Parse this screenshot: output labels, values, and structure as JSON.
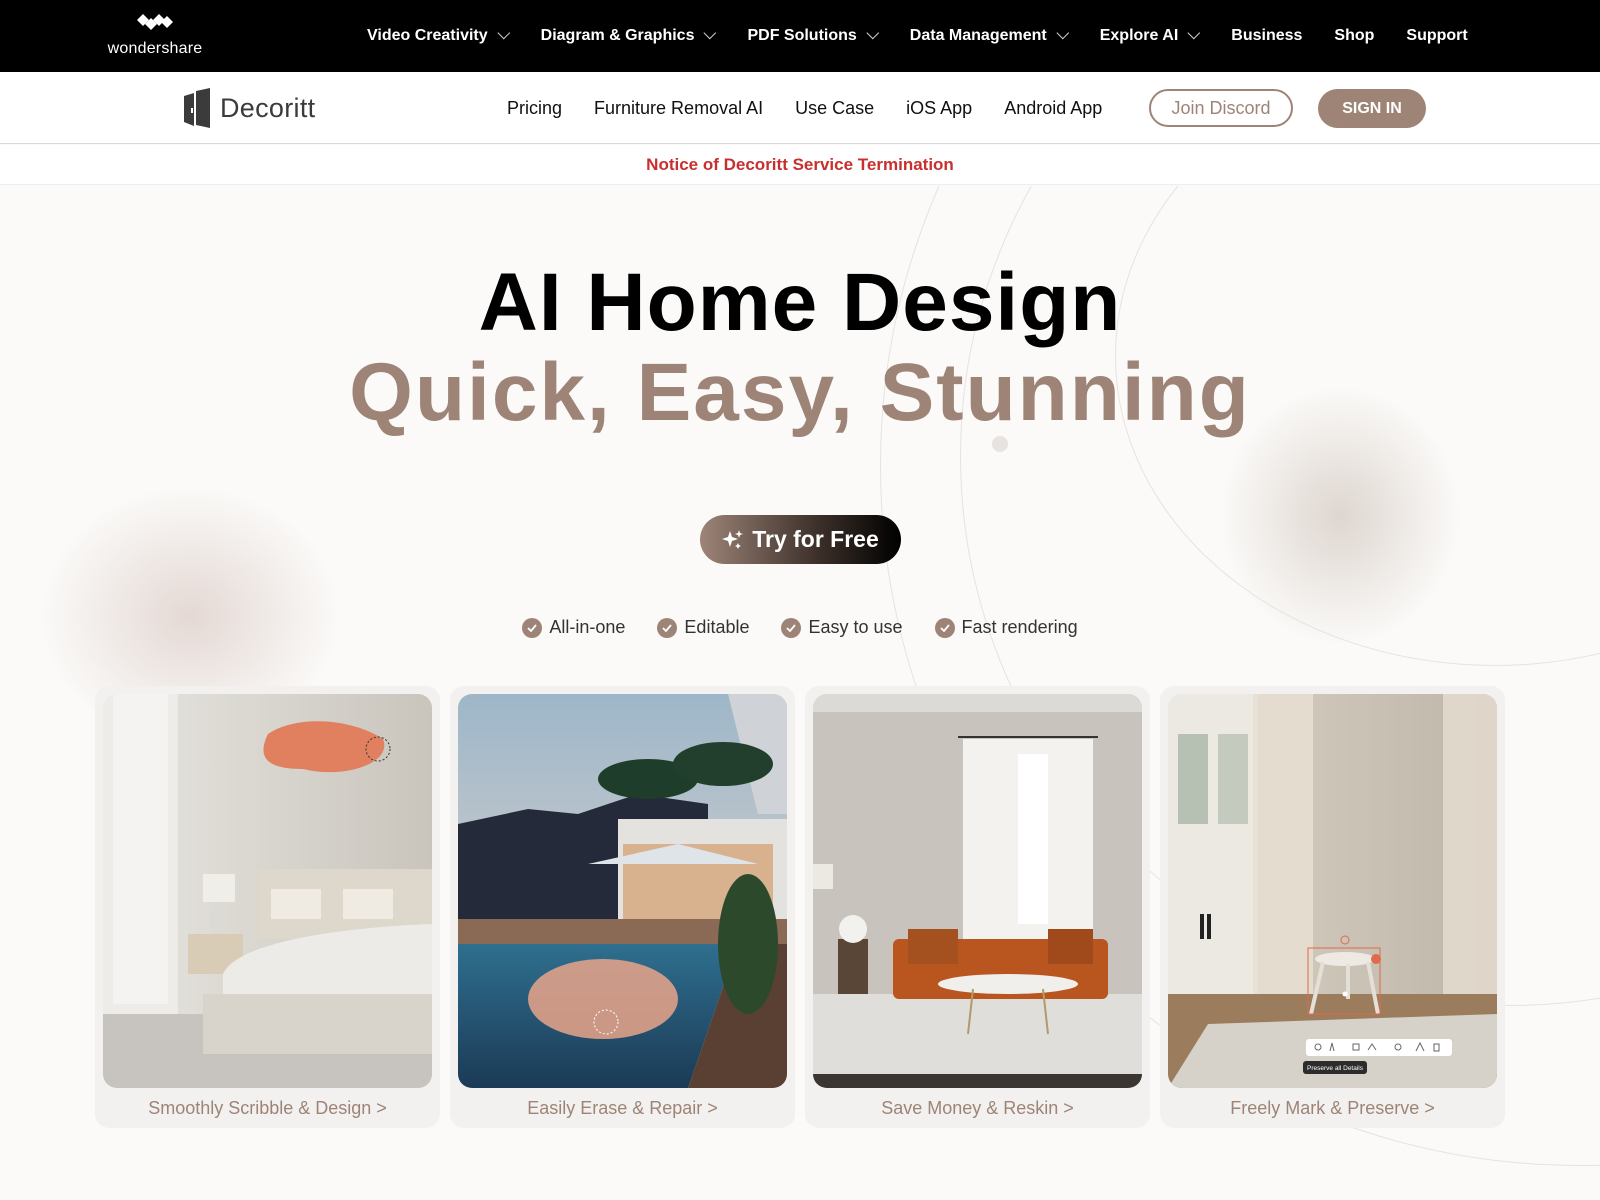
{
  "topbar": {
    "brand": "wondershare",
    "nav": [
      {
        "label": "Video Creativity",
        "dropdown": true
      },
      {
        "label": "Diagram & Graphics",
        "dropdown": true
      },
      {
        "label": "PDF Solutions",
        "dropdown": true
      },
      {
        "label": "Data Management",
        "dropdown": true
      },
      {
        "label": "Explore AI",
        "dropdown": true
      },
      {
        "label": "Business",
        "dropdown": false
      },
      {
        "label": "Shop",
        "dropdown": false
      },
      {
        "label": "Support",
        "dropdown": false
      }
    ]
  },
  "header": {
    "brand": "Decoritt",
    "nav": [
      "Pricing",
      "Furniture Removal AI",
      "Use Case",
      "iOS App",
      "Android App"
    ],
    "discord_label": "Join Discord",
    "signin_label": "SIGN IN"
  },
  "notice": {
    "text": "Notice of Decoritt Service Termination",
    "color": "#c8302f"
  },
  "hero": {
    "title_line1": "AI Home Design",
    "title_line2": "Quick, Easy, Stunning",
    "cta_label": "Try for Free",
    "features": [
      "All-in-one",
      "Editable",
      "Easy to use",
      "Fast rendering"
    ]
  },
  "cards": [
    {
      "caption": "Smoothly Scribble & Design >",
      "scene": "bedroom"
    },
    {
      "caption": "Easily Erase & Repair >",
      "scene": "pool"
    },
    {
      "caption": "Save Money & Reskin >",
      "scene": "living-room"
    },
    {
      "caption": "Freely Mark & Preserve >",
      "scene": "stool-room",
      "tooltip": "Preserve all Details"
    }
  ],
  "colors": {
    "accent": "#9d8477",
    "notice": "#c8302f",
    "topbar": "#000000"
  }
}
